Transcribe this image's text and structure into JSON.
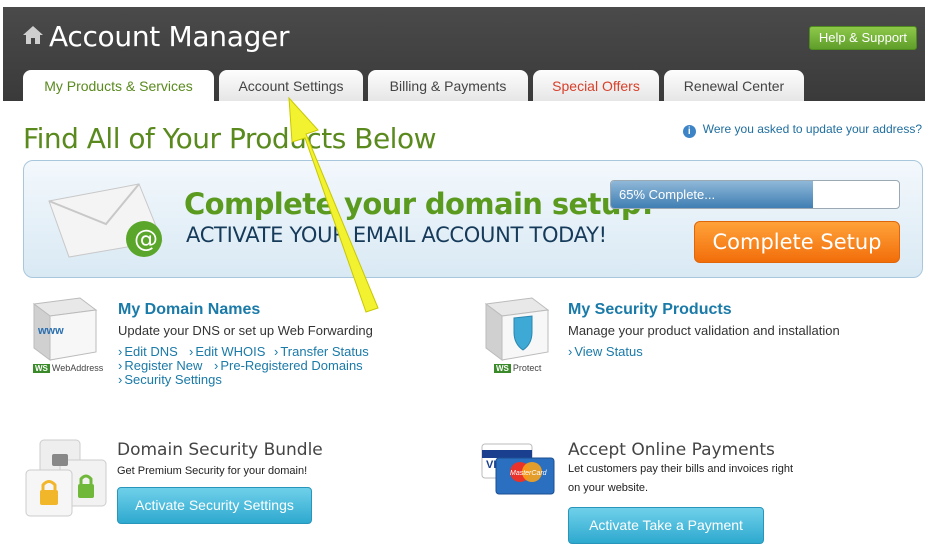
{
  "header": {
    "title": "Account Manager",
    "help_label": "Help & Support",
    "tabs": [
      {
        "label": "My Products & Services"
      },
      {
        "label": "Account Settings"
      },
      {
        "label": "Billing & Payments"
      },
      {
        "label": "Special Offers"
      },
      {
        "label": "Renewal Center"
      }
    ]
  },
  "page": {
    "title": "Find All of Your Products Below",
    "address_link": "Were you asked to update your address?"
  },
  "banner": {
    "headline": "Complete your domain setup!",
    "subline": "ACTIVATE YOUR EMAIL ACCOUNT TODAY!",
    "progress_text": "65% Complete...",
    "progress_fraction": 0.7,
    "button_label": "Complete Setup"
  },
  "domains": {
    "title": "My Domain Names",
    "desc": "Update your DNS or set up Web Forwarding",
    "logo_text": "WebAddress",
    "links": [
      "Edit DNS",
      "Edit WHOIS",
      "Transfer Status",
      "Register New",
      "Pre-Registered Domains",
      "Security Settings"
    ]
  },
  "security": {
    "title": "My Security Products",
    "desc": "Manage your product validation and installation",
    "logo_text": "Protect",
    "links": [
      "View Status"
    ]
  },
  "bundle": {
    "title": "Domain Security Bundle",
    "desc": "Get Premium Security for your domain!",
    "button_label": "Activate Security Settings"
  },
  "payments": {
    "title": "Accept Online Payments",
    "desc_line1": "Let customers pay their bills and invoices right",
    "desc_line2": "on your website.",
    "button_label": "Activate Take a Payment"
  },
  "colors": {
    "accent_green": "#5a8a1e",
    "link_blue": "#1a7aa8",
    "orange": "#f26e0a",
    "header_bg": "#404040"
  }
}
